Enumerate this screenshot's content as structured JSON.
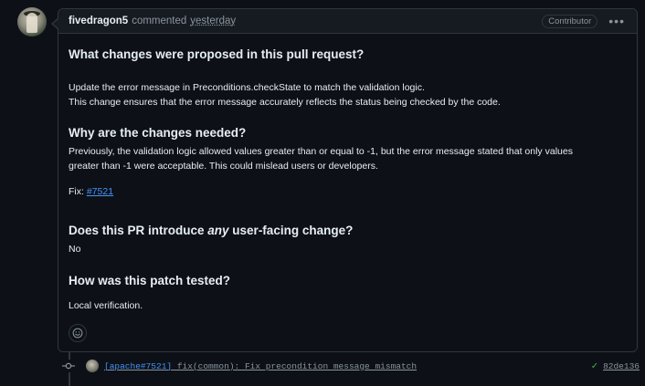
{
  "comment": {
    "author": "fivedragon5",
    "action": "commented",
    "timestamp": "yesterday",
    "role_badge": "Contributor",
    "menu_icon": "kebab-horizontal-icon",
    "sections": [
      {
        "heading": "What changes were proposed in this pull request?",
        "body_lines": [
          "Update the error message in Preconditions.checkState to match the validation logic.",
          "This change ensures that the error message accurately reflects the status being checked by the code."
        ]
      },
      {
        "heading": "Why are the changes needed?",
        "body_lines": [
          "Previously, the validation logic allowed values greater than or equal to -1, but the error message stated that only values",
          "greater than -1 were acceptable. This could mislead users or developers."
        ],
        "fix_label": "Fix:",
        "fix_link": "#7521"
      },
      {
        "heading_pre": "Does this PR introduce ",
        "heading_em": "any",
        "heading_post": " user-facing change?",
        "body": "No"
      },
      {
        "heading": "How was this patch tested?",
        "body": "Local verification."
      }
    ],
    "reaction_icon": "smiley-icon"
  },
  "commit": {
    "issue_ref": "[apache#7521]",
    "message": " fix(common): Fix precondition message mismatch",
    "status_icon": "check-icon",
    "sha": "82de136"
  }
}
